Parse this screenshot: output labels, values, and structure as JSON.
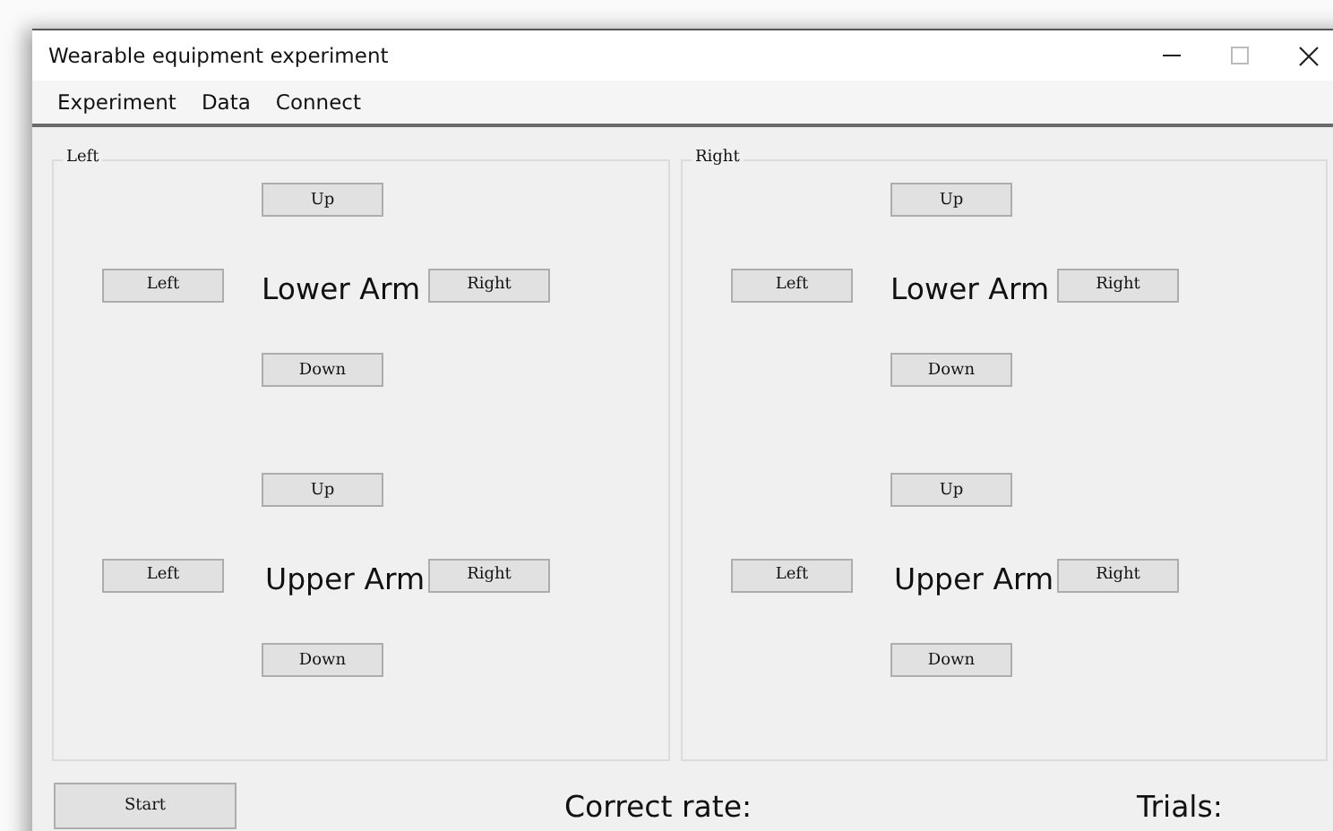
{
  "window": {
    "title": "Wearable equipment experiment"
  },
  "menu": [
    "Experiment",
    "Data",
    "Connect"
  ],
  "groups": [
    {
      "title": "Left",
      "sections": [
        {
          "label": "Lower Arm",
          "up": "Up",
          "left": "Left",
          "right": "Right",
          "down": "Down"
        },
        {
          "label": "Upper Arm",
          "up": "Up",
          "left": "Left",
          "right": "Right",
          "down": "Down"
        }
      ]
    },
    {
      "title": "Right",
      "sections": [
        {
          "label": "Lower Arm",
          "up": "Up",
          "left": "Left",
          "right": "Right",
          "down": "Down"
        },
        {
          "label": "Upper Arm",
          "up": "Up",
          "left": "Left",
          "right": "Right",
          "down": "Down"
        }
      ]
    }
  ],
  "start_button": "Start",
  "correct_rate_label": "Correct rate:",
  "trials_label": "Trials:"
}
